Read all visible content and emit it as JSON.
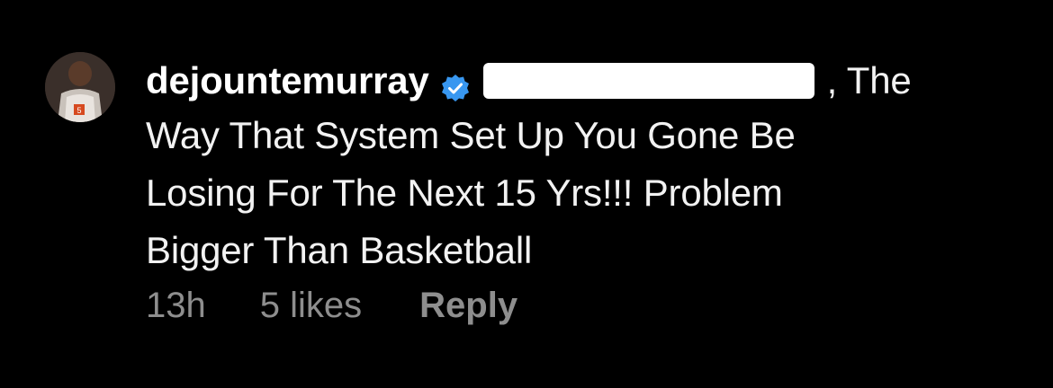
{
  "comment": {
    "username": "dejountemurray",
    "mention_tail": ", The",
    "text_lines": [
      "Way That System Set Up You Gone Be",
      "Losing For The Next 15 Yrs!!! Problem",
      "Bigger Than Basketball"
    ],
    "timestamp": "13h",
    "likes": "5 likes",
    "reply_label": "Reply"
  },
  "icons": {
    "verified": "verified-badge-icon",
    "avatar": "avatar"
  },
  "colors": {
    "background": "#000000",
    "text": "#f2f2f2",
    "meta": "#8e8e8e",
    "verified_blue": "#3897f0",
    "redaction": "#ffffff"
  }
}
